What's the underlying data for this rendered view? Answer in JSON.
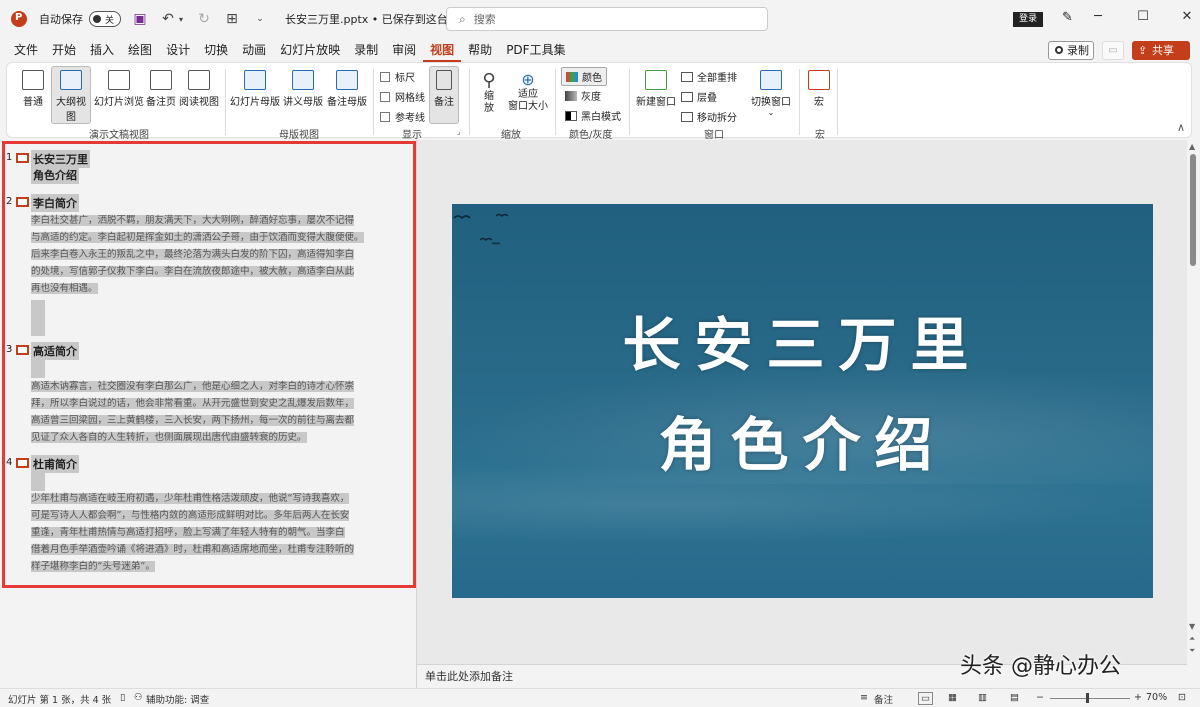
{
  "titlebar": {
    "autosave": "自动保存",
    "toggle_state": "关",
    "doc_title": "长安三万里.pptx • 已保存到这台电脑 ∨",
    "search_placeholder": "搜索",
    "login": "登录"
  },
  "menu": {
    "tabs": [
      "文件",
      "开始",
      "插入",
      "绘图",
      "设计",
      "切换",
      "动画",
      "幻灯片放映",
      "录制",
      "审阅",
      "视图",
      "帮助",
      "PDF工具集"
    ],
    "active": "视图",
    "record": "录制",
    "share": "共享"
  },
  "ribbon": {
    "presentation_views": {
      "label": "演示文稿视图",
      "buttons": [
        "普通",
        "大纲视图",
        "幻灯片浏览",
        "备注页",
        "阅读视图"
      ]
    },
    "master_views": {
      "label": "母版视图",
      "buttons": [
        "幻灯片母版",
        "讲义母版",
        "备注母版"
      ]
    },
    "show": {
      "label": "显示",
      "checkboxes": [
        "标尺",
        "网格线",
        "参考线"
      ],
      "notes": "备注"
    },
    "zoom": {
      "label": "缩放",
      "zoom_btn": "缩\n放",
      "fit_btn": "适应\n窗口大小"
    },
    "color": {
      "label": "颜色/灰度",
      "items": [
        "颜色",
        "灰度",
        "黑白模式"
      ]
    },
    "window": {
      "label": "窗口",
      "new_window": "新建窗口",
      "items": [
        "全部重排",
        "层叠",
        "移动拆分"
      ],
      "switch_window": "切换窗口"
    },
    "macro": {
      "label": "宏",
      "button": "宏"
    }
  },
  "outline": {
    "slides": [
      {
        "num": "1",
        "title": "长安三万里",
        "subtitle": "角色介绍"
      },
      {
        "num": "2",
        "title": "李白简介",
        "lines": [
          "李白社交甚广，洒脱不羁，朋友满天下，大大咧咧，醉酒好忘事，屡次不记得",
          "与高适的约定。李白起初是挥金如土的潇洒公子哥，由于饮酒而变得大腹便便。",
          "后来李白卷入永王的叛乱之中，最终沦落为满头白发的阶下囚，高适得知李白",
          "的处境，写信郭子仪救下李白。李白在流放夜郎途中，被大赦，高适李白从此",
          "再也没有相遇。"
        ]
      },
      {
        "num": "3",
        "title": "高适简介",
        "lines": [
          "高适木讷寡言，社交圈没有李白那么广，他是心细之人，对李白的诗才心怀崇",
          "拜，所以李白说过的话，他会非常看重。从开元盛世到安史之乱爆发后数年，",
          "高适曾三回梁园，三上黄鹤楼，三入长安，两下扬州，每一次的前往与离去都",
          "见证了众人各自的人生转折，也侧面展现出唐代由盛转衰的历史。"
        ]
      },
      {
        "num": "4",
        "title": "杜甫简介",
        "lines": [
          "少年杜甫与高适在岐王府初遇，少年杜甫性格活泼顽皮，他说“写诗我喜欢，",
          "可是写诗人人都会啊”，与性格内敛的高适形成鲜明对比。多年后两人在长安",
          "重逢，青年杜甫热情与高适打招呼，脸上写满了年轻人特有的朝气。当李白",
          "借着月色手举酒壶吟诵《将进酒》时，杜甫和高适席地而坐，杜甫专注聆听的",
          "样子堪称李白的“头号迷弟”。"
        ]
      }
    ]
  },
  "slide": {
    "line1": "长安三万里",
    "line2": "角色介绍"
  },
  "notes_placeholder": "单击此处添加备注",
  "status": {
    "slide_info": "幻灯片 第 1 张，共 4 张",
    "accessibility": "辅助功能: 调查",
    "notes": "备注",
    "zoom": "70%"
  },
  "watermark": "头条 @静心办公",
  "colors": {
    "accent": "#c43e1c",
    "highlight_border": "#e53935",
    "slide_bg": "#21607f"
  }
}
